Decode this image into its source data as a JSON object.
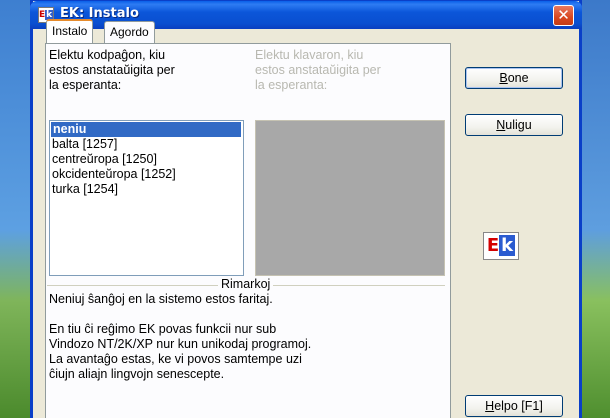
{
  "window": {
    "title": "EK: Instalo",
    "app_icon": "ek-icon",
    "close_icon": "close-icon"
  },
  "tabs": [
    {
      "label": "Instalo",
      "active": true
    },
    {
      "label": "Agordo",
      "active": false
    }
  ],
  "codepage_label": {
    "line1": "Elektu kodpaĝon, kiu",
    "line2": "estos anstataŭigita per",
    "line3": "la esperanta:"
  },
  "keyboard_label": {
    "line1": "Elektu klavaron, kiu",
    "line2": "estos anstataŭigita per",
    "line3": "la esperanta:"
  },
  "codepage_list": [
    {
      "label": "neniu",
      "selected": true
    },
    {
      "label": "balta [1257]",
      "selected": false
    },
    {
      "label": "centreŭropa [1250]",
      "selected": false
    },
    {
      "label": "okcidenteŭropa [1252]",
      "selected": false
    },
    {
      "label": "turka [1254]",
      "selected": false
    }
  ],
  "remarks": {
    "title": "Rimarkoj",
    "p1": "Neniuj ŝanĝoj en la sistemo estos faritaj.",
    "p2_line1": "En tiu ĉi reĝimo EK povas funkcii nur sub",
    "p2_line2": "Vindozo NT/2K/XP nur kun unikodaj programoj.",
    "p2_line3": "La avantaĝo estas, ke vi povos samtempe uzi",
    "p2_line4": "ĉiujn aliajn lingvojn senescepte."
  },
  "buttons": {
    "ok": {
      "underline": "B",
      "rest": "one"
    },
    "cancel": {
      "underline": "N",
      "rest": "uligu"
    },
    "help": {
      "underline": "H",
      "rest": "elpo [F1]"
    }
  },
  "logo": {
    "e": "E",
    "k": "k"
  },
  "colors": {
    "titlebar": "#0a4fd0",
    "selection": "#316ac5",
    "tab_accent": "#e68b2c",
    "disabled_list": "#a8a8a8"
  }
}
